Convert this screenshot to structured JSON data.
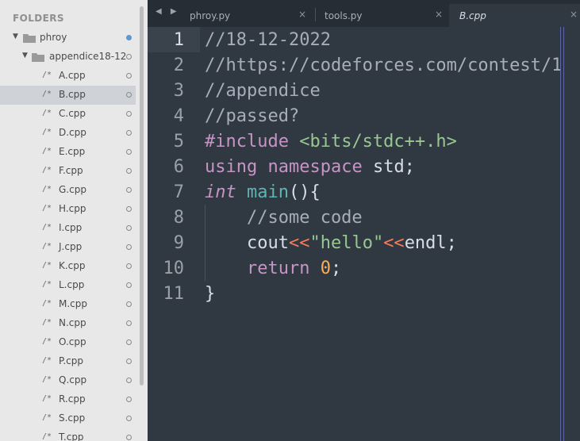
{
  "sidebar": {
    "header": "FOLDERS",
    "root": {
      "label": "phroy"
    },
    "subfolder": {
      "label": "appendice18-12"
    },
    "files": [
      "A.cpp",
      "B.cpp",
      "C.cpp",
      "D.cpp",
      "E.cpp",
      "F.cpp",
      "G.cpp",
      "H.cpp",
      "I.cpp",
      "J.cpp",
      "K.cpp",
      "L.cpp",
      "M.cpp",
      "N.cpp",
      "O.cpp",
      "P.cpp",
      "Q.cpp",
      "R.cpp",
      "S.cpp",
      "T.cpp"
    ],
    "file_icon": "/*",
    "selected": "B.cpp"
  },
  "tabs": [
    {
      "label": "phroy.py",
      "close": "×"
    },
    {
      "label": "tools.py",
      "close": "×"
    },
    {
      "label": "B.cpp",
      "close": "×",
      "active": true
    }
  ],
  "nav_arrows": "◀ ▶",
  "editor": {
    "line_numbers": [
      "1",
      "2",
      "3",
      "4",
      "5",
      "6",
      "7",
      "8",
      "9",
      "10",
      "11"
    ],
    "current_line": 1,
    "lines": {
      "l1": "//18-12-2022",
      "l2": "//https://codeforces.com/contest/1",
      "l3": "//appendice",
      "l4": "//passed?",
      "l5_pp": "#include",
      "l5_inc": " <bits/stdc++.h>",
      "l6_kw1": "using",
      "l6_kw2": "namespace",
      "l6_rest": " std;",
      "l7_type": "int",
      "l7_fn": "main",
      "l7_rest": "(){",
      "l8": "    //some code",
      "l9_a": "    cout",
      "l9_op1": "<<",
      "l9_str": "\"hello\"",
      "l9_op2": "<<",
      "l9_b": "endl;",
      "l10_kw": "    return",
      "l10_num": "0",
      "l10_rest": ";",
      "l11": "}"
    }
  },
  "colors": {
    "editor_bg": "#303841",
    "sidebar_bg": "#e8e8e8",
    "comment": "#a7adba",
    "keyword": "#c695c6",
    "string": "#99c794",
    "operator": "#f97b58",
    "number": "#f9ae58",
    "function": "#5fb4b4"
  }
}
